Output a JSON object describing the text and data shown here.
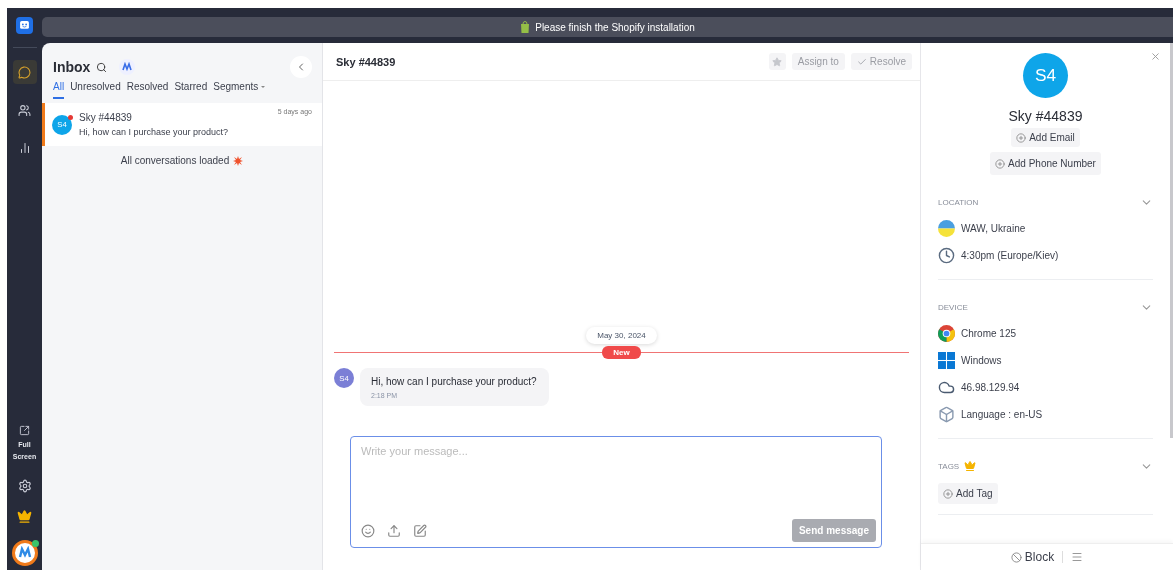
{
  "banner": {
    "text": "Please finish the Shopify installation"
  },
  "nav": [
    {
      "kind": "chat",
      "selected": true
    },
    {
      "kind": "contacts",
      "selected": false
    },
    {
      "kind": "reports",
      "selected": false
    }
  ],
  "full_screen": {
    "label": "Full Screen"
  },
  "inbox": {
    "title": "Inbox",
    "tabs": [
      {
        "label": "All",
        "selected": true
      },
      {
        "label": "Unresolved",
        "selected": false
      },
      {
        "label": "Resolved",
        "selected": false
      },
      {
        "label": "Starred",
        "selected": false
      },
      {
        "label": "Segments",
        "selected": false,
        "dropdown": true
      }
    ],
    "conversations": [
      {
        "avatar": "S4",
        "name": "Sky #44839",
        "time": "5 days ago",
        "preview": "Hi, how can I purchase your product?",
        "unread": true,
        "selected": true
      }
    ],
    "footer": "All conversations loaded"
  },
  "chat": {
    "title": "Sky #44839",
    "starred": false,
    "assign": "Assign to",
    "resolve": "Resolve",
    "date": "May 30, 2024",
    "new_badge": "New",
    "messages": [
      {
        "avatar": "S4",
        "text": "Hi, how can I purchase your product?",
        "time": "2:18 PM"
      }
    ],
    "composer": {
      "placeholder": "Write your message...",
      "send": "Send message",
      "send_disabled": true
    }
  },
  "contact": {
    "avatar": "S4",
    "name": "Sky #44839",
    "add_email": "Add Email",
    "add_phone": "Add Phone Number",
    "sections": [
      {
        "title": "LOCATION",
        "premium": false,
        "items": [
          {
            "kind": "flag",
            "text": "WAW, Ukraine"
          },
          {
            "kind": "clock",
            "text": "4:30pm (Europe/Kiev)"
          }
        ]
      },
      {
        "title": "DEVICE",
        "premium": false,
        "items": [
          {
            "kind": "chrome",
            "text": "Chrome 125"
          },
          {
            "kind": "windows",
            "text": "Windows"
          },
          {
            "kind": "ip",
            "text": "46.98.129.94"
          },
          {
            "kind": "language",
            "text": "Language : en-US"
          }
        ]
      },
      {
        "title": "TAGS",
        "premium": true,
        "add": "Add Tag"
      }
    ],
    "block": "Block"
  }
}
